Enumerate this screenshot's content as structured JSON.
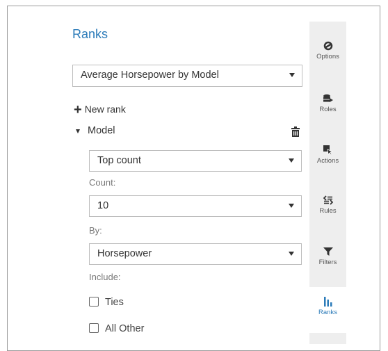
{
  "panel": {
    "title": "Ranks",
    "report_select": {
      "value": "Average Horsepower by Model"
    },
    "new_rank_label": "New rank",
    "rank_item": {
      "label": "Model"
    },
    "type_select": {
      "value": "Top count"
    },
    "count_label": "Count:",
    "count_select": {
      "value": "10"
    },
    "by_label": "By:",
    "by_select": {
      "value": "Horsepower"
    },
    "include_label": "Include:",
    "checkboxes": [
      {
        "label": "Ties",
        "checked": false
      },
      {
        "label": "All Other",
        "checked": false
      }
    ]
  },
  "sidebar": {
    "items": [
      {
        "label": "Options",
        "icon": "options-icon",
        "active": false
      },
      {
        "label": "Roles",
        "icon": "roles-icon",
        "active": false
      },
      {
        "label": "Actions",
        "icon": "actions-icon",
        "active": false
      },
      {
        "label": "Rules",
        "icon": "rules-icon",
        "active": false
      },
      {
        "label": "Filters",
        "icon": "filter-icon",
        "active": false
      },
      {
        "label": "Ranks",
        "icon": "ranks-icon",
        "active": true
      }
    ]
  },
  "colors": {
    "accent": "#2b7bb9",
    "sidebar_bg": "#eeeeee",
    "border": "#bdbdbd"
  }
}
